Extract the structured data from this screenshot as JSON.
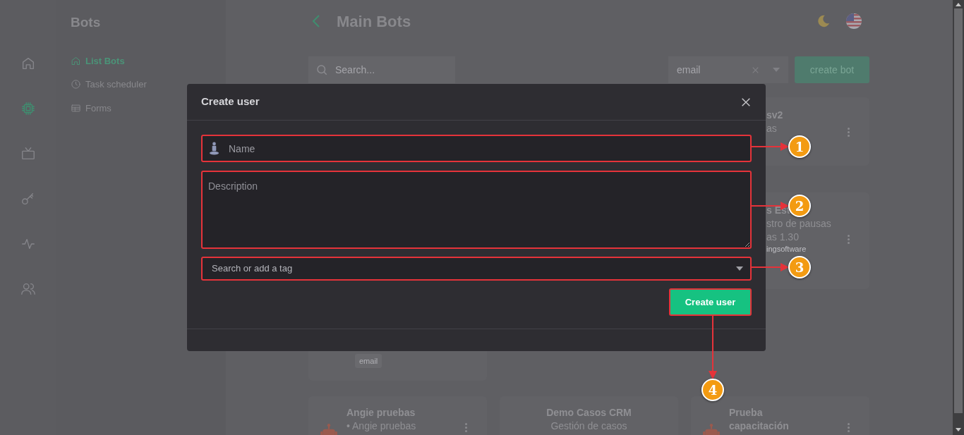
{
  "icon_sidebar": {
    "items": [
      {
        "selected": false
      },
      {
        "selected": true
      },
      {
        "selected": false
      },
      {
        "selected": false
      },
      {
        "selected": false
      },
      {
        "selected": false
      }
    ]
  },
  "sidebar": {
    "title": "Bots",
    "items": [
      {
        "label": "List Bots",
        "selected": true
      },
      {
        "label": "Task scheduler",
        "selected": false
      },
      {
        "label": "Forms",
        "selected": false
      }
    ]
  },
  "header": {
    "title": "Main Bots"
  },
  "toolbar": {
    "search": {
      "placeholder": "Search..."
    },
    "filter": {
      "value": "email"
    },
    "create_button": "create bot"
  },
  "cards": [
    {
      "title": "sv2",
      "lines": [
        "as"
      ],
      "menu": true
    },
    {
      "tags": [
        "email"
      ],
      "menu": false
    },
    {
      "title": "s Est",
      "lines": [
        "stro de pausas",
        "as 1.30"
      ],
      "note": "ingsoftware",
      "menu": true
    },
    {
      "kind": "robot",
      "title": "Angie pruebas",
      "lines": [
        "• Angie pruebas"
      ],
      "menu": true
    },
    {
      "kind": "plain",
      "title": "Demo Casos CRM",
      "lines": [
        "Gestión de casos"
      ],
      "menu": false
    },
    {
      "kind": "robot",
      "title": "Prueba capacitación",
      "menu": true
    }
  ],
  "modal": {
    "title": "Create user",
    "name_field": {
      "placeholder": "Name"
    },
    "description_field": {
      "placeholder": "Description"
    },
    "tag_select": {
      "placeholder": "Search or add a tag"
    },
    "submit_button": "Create user"
  },
  "annotations": [
    {
      "number": "1"
    },
    {
      "number": "2"
    },
    {
      "number": "3"
    },
    {
      "number": "4"
    }
  ]
}
